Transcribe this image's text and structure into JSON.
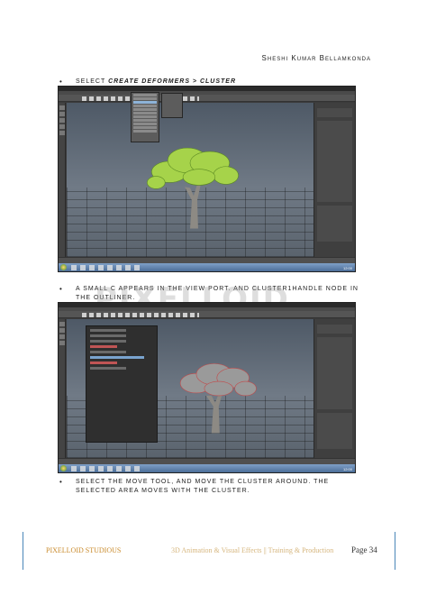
{
  "header": {
    "author": "Sheshi Kumar Bellamkonda"
  },
  "steps": [
    {
      "bullet": "•",
      "prefix": "Select ",
      "menu_path": "Create Deformers > Cluster"
    },
    {
      "bullet": "•",
      "text": "A small C appears in the view port. and cluster1Handle node in the outliner."
    },
    {
      "bullet": "•",
      "text": "Select the Move tool, and move the cluster around. The selected area moves with the cluster."
    }
  ],
  "screenshots": [
    {
      "description": "maya-viewport-with-create-deformers-menu",
      "taskbar_clock": "12:00"
    },
    {
      "description": "maya-viewport-with-outliner-cluster",
      "taskbar_clock": "12:00"
    }
  ],
  "watermark": {
    "text": "PIXELLOID",
    "sub": "3D"
  },
  "footer": {
    "studio": "PIXELLOID STUDIOUS",
    "tagline": "3D Animation & Visual Effects || Training & Production",
    "page": "Page 34"
  },
  "colors": {
    "footer_line": "#4a86b8",
    "studio": "#c98a2b",
    "tree_foliage": "#a6d34a"
  }
}
